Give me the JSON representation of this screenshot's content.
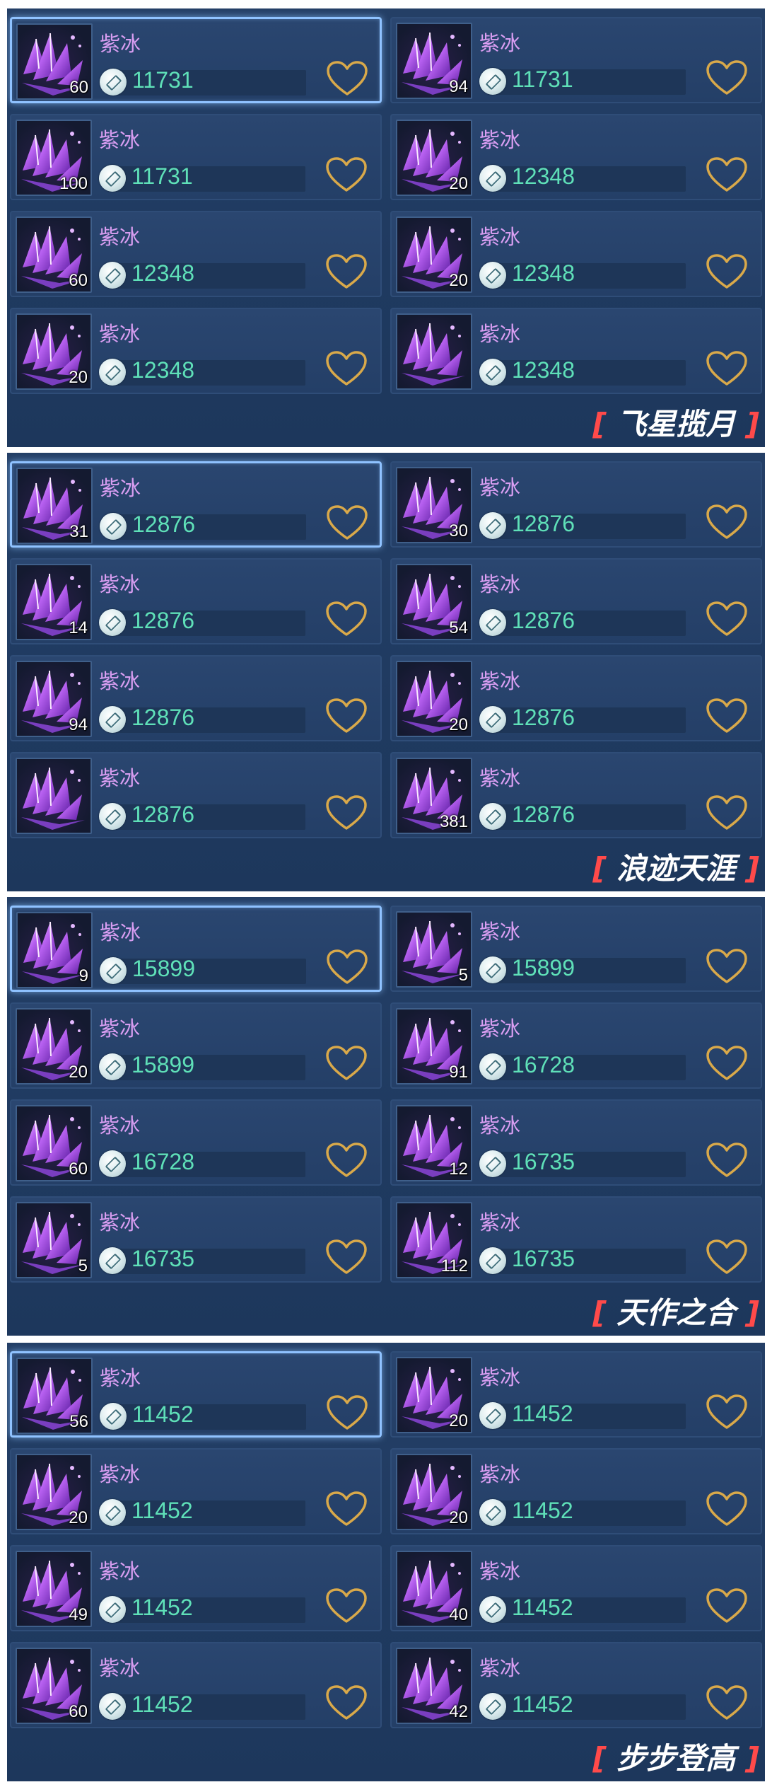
{
  "currency_icon": "coin-icon",
  "favorite_icon": "heart-icon",
  "colors": {
    "item_name": "#d99ef2",
    "price": "#5fe0b8",
    "heart": "#d9a94a",
    "bracket": "#ff4a4a",
    "selected_border": "#8fc2ff"
  },
  "panels": [
    {
      "title": "飞星揽月",
      "listings": [
        {
          "name": "紫冰",
          "qty": "60",
          "price": "11731",
          "selected": true
        },
        {
          "name": "紫冰",
          "qty": "94",
          "price": "11731",
          "selected": false
        },
        {
          "name": "紫冰",
          "qty": "100",
          "price": "11731",
          "selected": false
        },
        {
          "name": "紫冰",
          "qty": "20",
          "price": "12348",
          "selected": false
        },
        {
          "name": "紫冰",
          "qty": "60",
          "price": "12348",
          "selected": false
        },
        {
          "name": "紫冰",
          "qty": "20",
          "price": "12348",
          "selected": false
        },
        {
          "name": "紫冰",
          "qty": "20",
          "price": "12348",
          "selected": false
        },
        {
          "name": "紫冰",
          "qty": "",
          "price": "12348",
          "selected": false
        }
      ]
    },
    {
      "title": "浪迹天涯",
      "listings": [
        {
          "name": "紫冰",
          "qty": "31",
          "price": "12876",
          "selected": true
        },
        {
          "name": "紫冰",
          "qty": "30",
          "price": "12876",
          "selected": false
        },
        {
          "name": "紫冰",
          "qty": "14",
          "price": "12876",
          "selected": false
        },
        {
          "name": "紫冰",
          "qty": "54",
          "price": "12876",
          "selected": false
        },
        {
          "name": "紫冰",
          "qty": "94",
          "price": "12876",
          "selected": false
        },
        {
          "name": "紫冰",
          "qty": "20",
          "price": "12876",
          "selected": false
        },
        {
          "name": "紫冰",
          "qty": "",
          "price": "12876",
          "selected": false
        },
        {
          "name": "紫冰",
          "qty": "381",
          "price": "12876",
          "selected": false
        }
      ]
    },
    {
      "title": "天作之合",
      "listings": [
        {
          "name": "紫冰",
          "qty": "9",
          "price": "15899",
          "selected": true
        },
        {
          "name": "紫冰",
          "qty": "5",
          "price": "15899",
          "selected": false
        },
        {
          "name": "紫冰",
          "qty": "20",
          "price": "15899",
          "selected": false
        },
        {
          "name": "紫冰",
          "qty": "91",
          "price": "16728",
          "selected": false
        },
        {
          "name": "紫冰",
          "qty": "60",
          "price": "16728",
          "selected": false
        },
        {
          "name": "紫冰",
          "qty": "12",
          "price": "16735",
          "selected": false
        },
        {
          "name": "紫冰",
          "qty": "5",
          "price": "16735",
          "selected": false
        },
        {
          "name": "紫冰",
          "qty": "112",
          "price": "16735",
          "selected": false
        }
      ]
    },
    {
      "title": "步步登高",
      "listings": [
        {
          "name": "紫冰",
          "qty": "56",
          "price": "11452",
          "selected": true
        },
        {
          "name": "紫冰",
          "qty": "20",
          "price": "11452",
          "selected": false
        },
        {
          "name": "紫冰",
          "qty": "20",
          "price": "11452",
          "selected": false
        },
        {
          "name": "紫冰",
          "qty": "20",
          "price": "11452",
          "selected": false
        },
        {
          "name": "紫冰",
          "qty": "49",
          "price": "11452",
          "selected": false
        },
        {
          "name": "紫冰",
          "qty": "40",
          "price": "11452",
          "selected": false
        },
        {
          "name": "紫冰",
          "qty": "60",
          "price": "11452",
          "selected": false
        },
        {
          "name": "紫冰",
          "qty": "42",
          "price": "11452",
          "selected": false
        }
      ]
    }
  ]
}
